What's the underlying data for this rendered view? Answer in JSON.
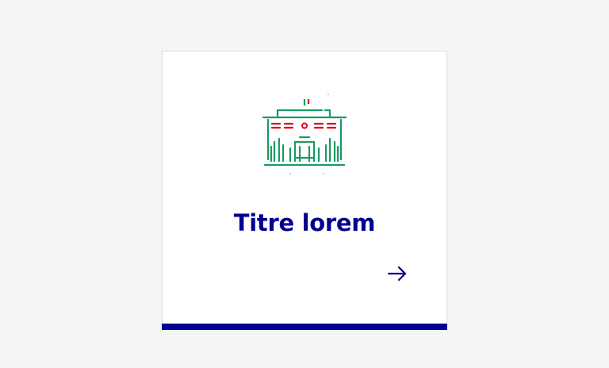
{
  "tile": {
    "title": "Titre lorem",
    "pictogram_icon": "government-building-icon",
    "arrow_icon": "arrow-right-icon"
  },
  "colors": {
    "background": "#f5f5f5",
    "tile_background": "#ffffff",
    "accent_blue": "#000091",
    "pictogram_green": "#169b62",
    "pictogram_red": "#e1000f"
  }
}
